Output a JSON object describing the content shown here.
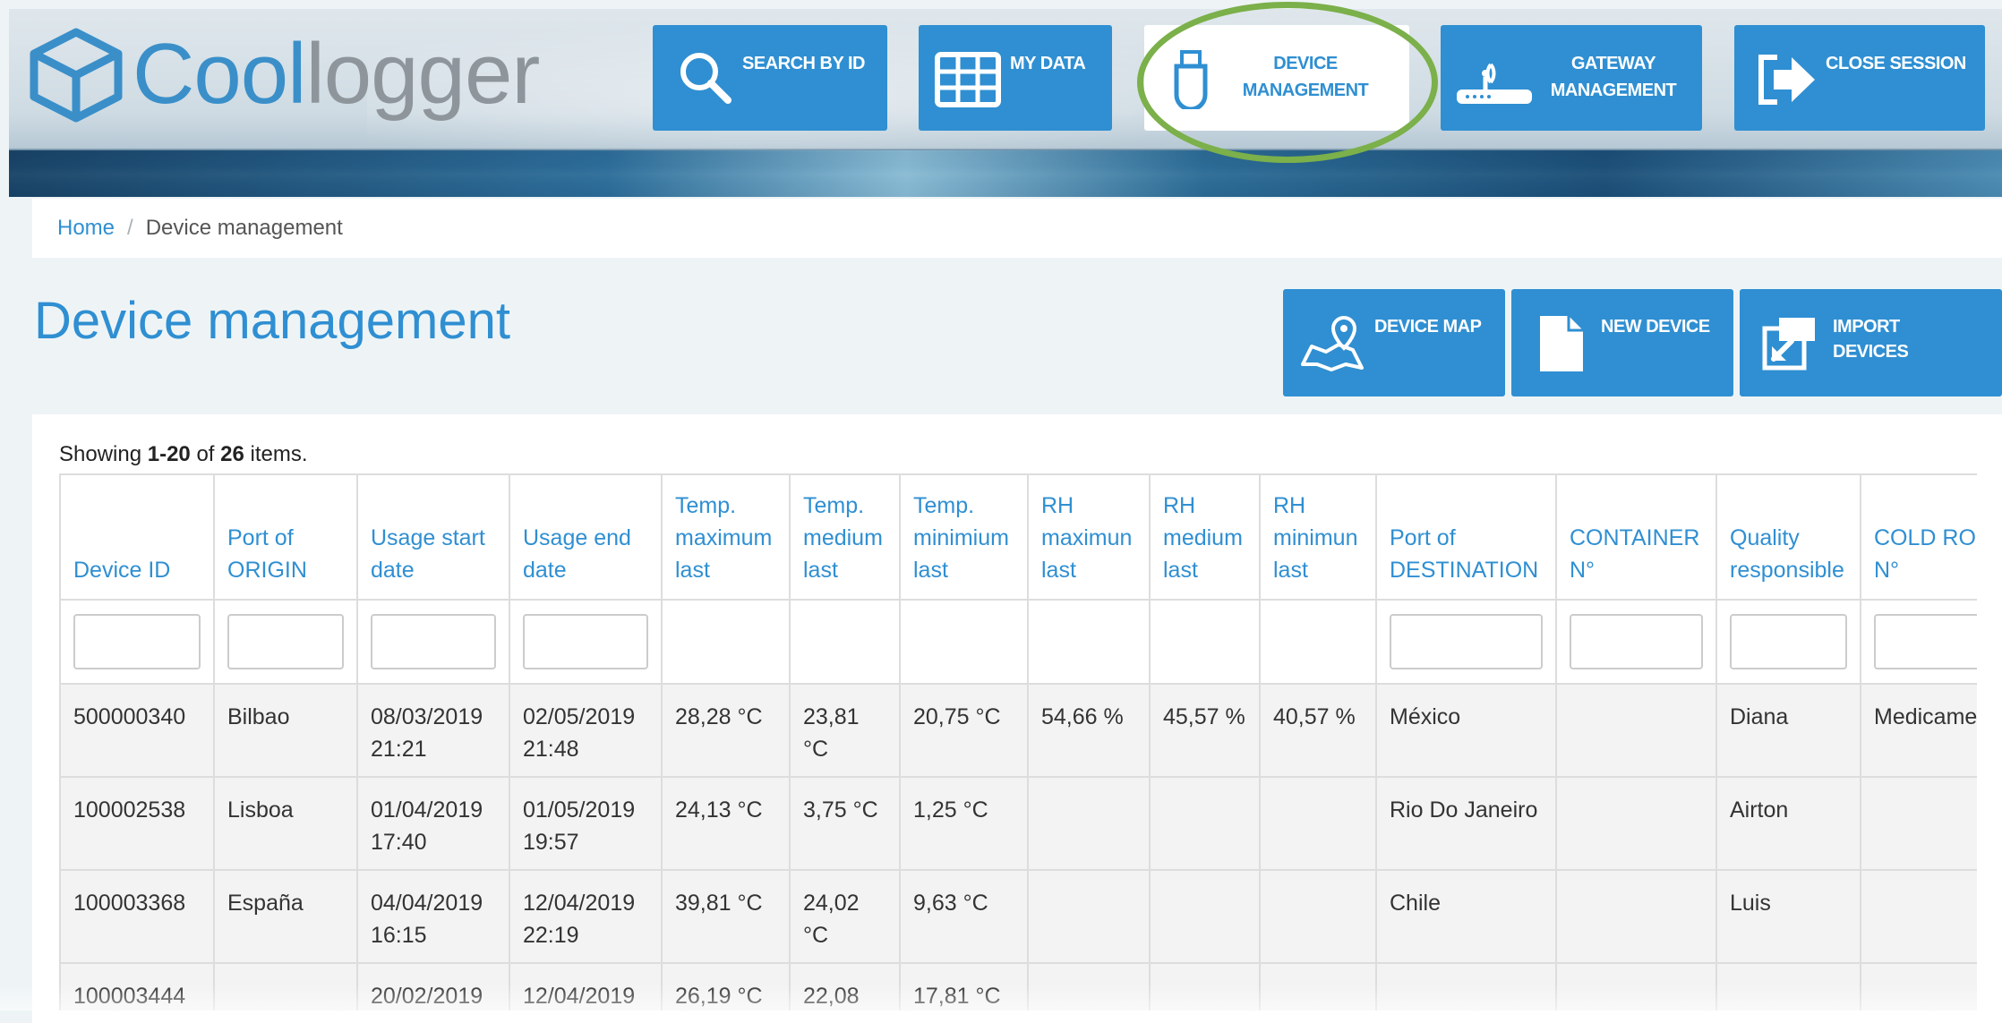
{
  "logo": {
    "part1": "Cool",
    "part2": "logger"
  },
  "nav": [
    {
      "line1": "SEARCH BY ID",
      "line2": "",
      "icon": "search-icon"
    },
    {
      "line1": "MY DATA",
      "line2": "",
      "icon": "grid-icon"
    },
    {
      "line1": "DEVICE",
      "line2": "MANAGEMENT",
      "icon": "usb-icon",
      "active": true
    },
    {
      "line1": "GATEWAY",
      "line2": "MANAGEMENT",
      "icon": "router-icon"
    },
    {
      "line1": "CLOSE SESSION",
      "line2": "",
      "icon": "logout-icon"
    }
  ],
  "breadcrumb": {
    "home": "Home",
    "separator": "/",
    "current": "Device management"
  },
  "page": {
    "title": "Device management"
  },
  "actions": [
    {
      "line1": "DEVICE MAP",
      "line2": "",
      "icon": "map-pin-icon"
    },
    {
      "line1": "NEW DEVICE",
      "line2": "",
      "icon": "document-icon"
    },
    {
      "line1": "IMPORT",
      "line2": "DEVICES",
      "icon": "import-icon"
    }
  ],
  "table": {
    "summary": {
      "prefix": "Showing ",
      "range": "1-20",
      "middle": " of ",
      "total": "26",
      "suffix": " items."
    },
    "columns": [
      [
        "Device ID"
      ],
      [
        "Port of",
        "ORIGIN"
      ],
      [
        "Usage start",
        "date"
      ],
      [
        "Usage end",
        "date"
      ],
      [
        "Temp.",
        "maximum",
        "last"
      ],
      [
        "Temp.",
        "medium",
        "last"
      ],
      [
        "Temp.",
        "minimium",
        "last"
      ],
      [
        "RH",
        "maximun",
        "last"
      ],
      [
        "RH",
        "medium",
        "last"
      ],
      [
        "RH",
        "minimun",
        "last"
      ],
      [
        "Port of",
        "DESTINATION"
      ],
      [
        "CONTAINER",
        "N°"
      ],
      [
        "Quality",
        "responsible"
      ],
      [
        "COLD ROOM",
        "N°"
      ]
    ],
    "filterable": [
      true,
      true,
      true,
      true,
      false,
      false,
      false,
      false,
      false,
      false,
      true,
      true,
      true,
      true
    ],
    "rows": [
      [
        [
          "500000340"
        ],
        [
          "Bilbao"
        ],
        [
          "08/03/2019",
          "21:21"
        ],
        [
          "02/05/2019",
          "21:48"
        ],
        [
          "28,28 °C"
        ],
        [
          "23,81",
          "°C"
        ],
        [
          "20,75 °C"
        ],
        [
          "54,66 %"
        ],
        [
          "45,57 %"
        ],
        [
          "40,57 %"
        ],
        [
          "México"
        ],
        [
          ""
        ],
        [
          "Diana"
        ],
        [
          "Medicamentos"
        ]
      ],
      [
        [
          "100002538"
        ],
        [
          "Lisboa"
        ],
        [
          "01/04/2019",
          "17:40"
        ],
        [
          "01/05/2019",
          "19:57"
        ],
        [
          "24,13 °C"
        ],
        [
          "3,75 °C"
        ],
        [
          "1,25 °C"
        ],
        [
          ""
        ],
        [
          ""
        ],
        [
          ""
        ],
        [
          "Rio Do Janeiro"
        ],
        [
          ""
        ],
        [
          "Airton"
        ],
        [
          ""
        ]
      ],
      [
        [
          "100003368"
        ],
        [
          "España"
        ],
        [
          "04/04/2019",
          "16:15"
        ],
        [
          "12/04/2019",
          "22:19"
        ],
        [
          "39,81 °C"
        ],
        [
          "24,02",
          "°C"
        ],
        [
          "9,63 °C"
        ],
        [
          ""
        ],
        [
          ""
        ],
        [
          ""
        ],
        [
          "Chile"
        ],
        [
          ""
        ],
        [
          "Luis"
        ],
        [
          ""
        ]
      ],
      [
        [
          "100003444"
        ],
        [
          ""
        ],
        [
          "20/02/2019",
          ""
        ],
        [
          "12/04/2019",
          ""
        ],
        [
          "26,19 °C"
        ],
        [
          "22,08",
          ""
        ],
        [
          "17,81 °C"
        ],
        [
          ""
        ],
        [
          ""
        ],
        [
          ""
        ],
        [
          ""
        ],
        [
          ""
        ],
        [
          ""
        ],
        [
          ""
        ]
      ]
    ]
  },
  "colors": {
    "accent": "#2f8fd2",
    "highlight_ring": "#7bb04a",
    "logo_grey": "#8e969c"
  }
}
